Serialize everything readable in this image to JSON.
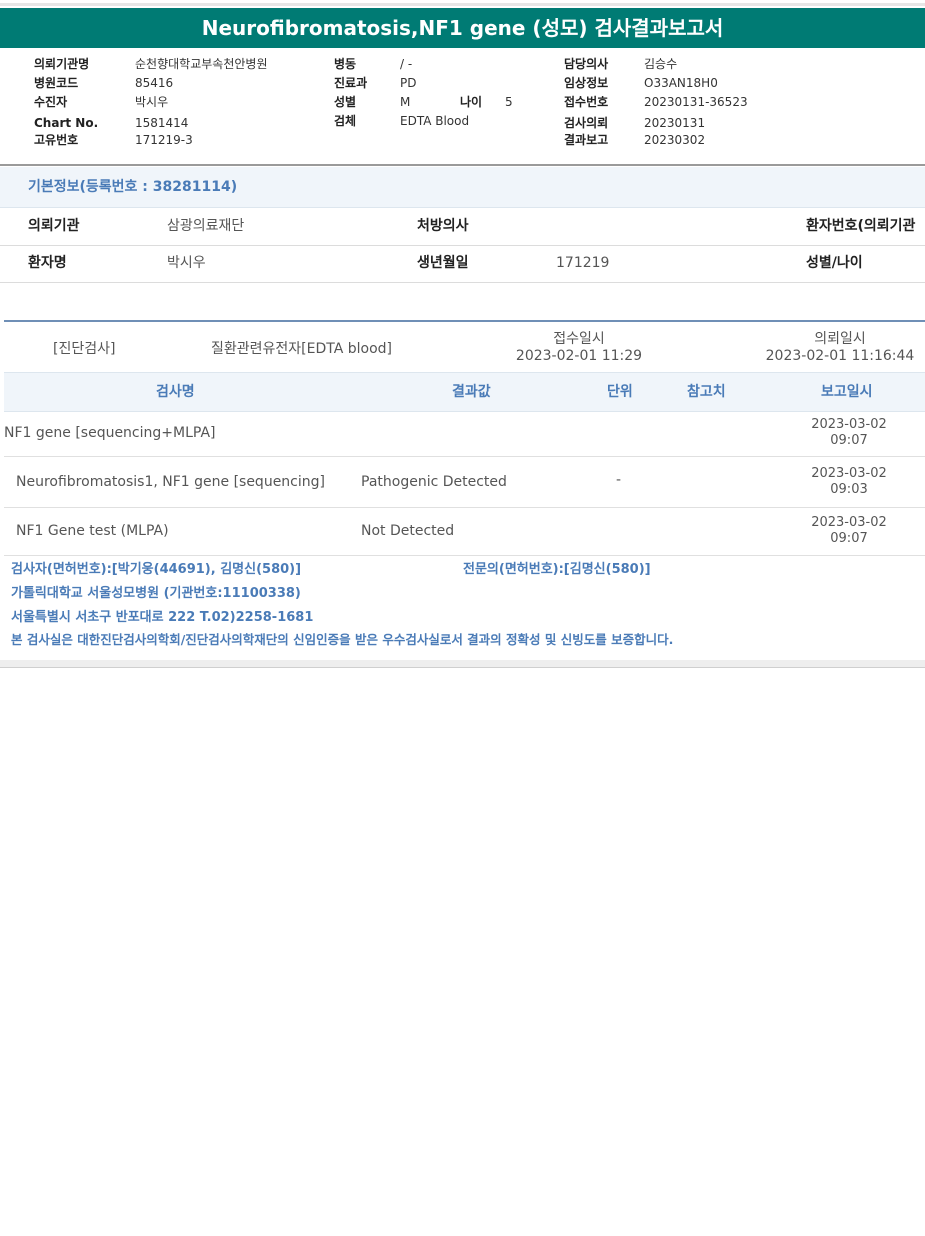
{
  "title": "Neurofibromatosis,NF1 gene (성모) 검사결과보고서",
  "header": {
    "col1": [
      {
        "k": "의뢰기관명",
        "v": "순천향대학교부속천안병원"
      },
      {
        "k": "병원코드",
        "v": "85416"
      },
      {
        "k": "수진자",
        "v": "박시우"
      },
      {
        "k": "Chart No.",
        "v": "1581414"
      },
      {
        "k": "고유번호",
        "v": "171219-3"
      }
    ],
    "col2": [
      {
        "k": "병동",
        "v": "/ -"
      },
      {
        "k": "진료과",
        "v": "PD"
      },
      {
        "k": "성별",
        "v": "M"
      },
      {
        "k": "검체",
        "v": "EDTA Blood"
      }
    ],
    "age": {
      "k": "나이",
      "v": "5"
    },
    "col3": [
      {
        "k": "담당의사",
        "v": "김승수"
      },
      {
        "k": "임상정보",
        "v": "O33AN18H0"
      },
      {
        "k": "접수번호",
        "v": "20230131-36523"
      },
      {
        "k": "검사의뢰",
        "v": "20230131"
      },
      {
        "k": "결과보고",
        "v": "20230302"
      }
    ]
  },
  "basic": {
    "heading": "기본정보(등록번호 : 38281114)",
    "row1": {
      "k1": "의뢰기관",
      "v1": "삼광의료재단",
      "k2": "처방의사",
      "v2": "",
      "k3": "환자번호(의뢰기관"
    },
    "row2": {
      "k1": "환자명",
      "v1": "박시우",
      "k2": "생년월일",
      "v2": "171219",
      "k3": "성별/나이"
    }
  },
  "diag": {
    "type": "[진단검사]",
    "name": "질환관련유전자[EDTA blood]",
    "received_label": "접수일시",
    "received": "2023-02-01 11:29",
    "requested_label": "의뢰일시",
    "requested": "2023-02-01 11:16:44"
  },
  "table": {
    "headers": {
      "name": "검사명",
      "result": "결과값",
      "unit": "단위",
      "ref": "참고치",
      "date": "보고일시"
    },
    "rows": [
      {
        "name": "NF1 gene [sequencing+MLPA]",
        "result": "",
        "unit": "",
        "date1": "2023-03-02",
        "date2": "09:07"
      },
      {
        "name": "Neurofibromatosis1, NF1 gene [sequencing]",
        "result": "Pathogenic Detected",
        "unit": "-",
        "date1": "2023-03-02",
        "date2": "09:03"
      },
      {
        "name": "NF1 Gene test (MLPA)",
        "result": "Not Detected",
        "unit": "",
        "date1": "2023-03-02",
        "date2": "09:07"
      }
    ]
  },
  "footer": {
    "tester": "검사자(면허번호):[박기웅(44691), 김명신(580)]",
    "specialist": "전문의(면허번호):[김명신(580)]",
    "hospital": "가톨릭대학교 서울성모병원 (기관번호:11100338)",
    "address": "서울특별시 서초구 반포대로 222 T.02)2258-1681",
    "certification": "본 검사실은 대한진단검사의학회/진단검사의학재단의 신임인증을 받은 우수검사실로서 결과의 정확성 및 신빙도를 보증합니다."
  }
}
